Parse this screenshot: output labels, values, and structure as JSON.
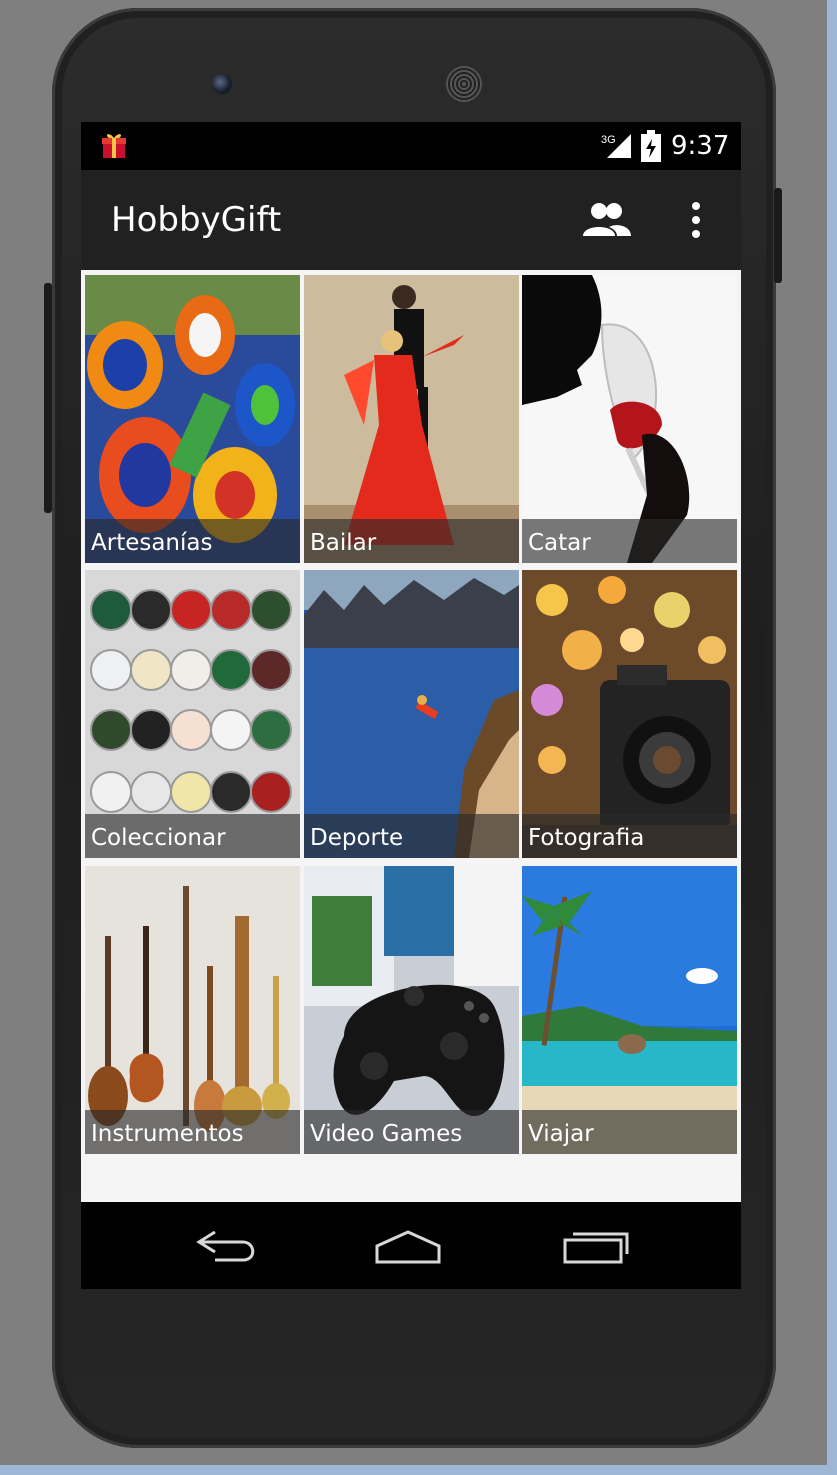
{
  "status_bar": {
    "network": "3G",
    "time": "9:37"
  },
  "app_bar": {
    "title": "HobbyGift",
    "actions": [
      {
        "icon": "people-icon"
      },
      {
        "icon": "more-vert-icon"
      }
    ]
  },
  "hobbies": [
    {
      "label": "Artesanías"
    },
    {
      "label": "Bailar"
    },
    {
      "label": "Catar"
    },
    {
      "label": "Coleccionar"
    },
    {
      "label": "Deporte"
    },
    {
      "label": "Fotografia"
    },
    {
      "label": "Instrumentos"
    },
    {
      "label": "Video Games"
    },
    {
      "label": "Viajar"
    }
  ],
  "nav_bar": {
    "buttons": [
      {
        "icon": "back-icon"
      },
      {
        "icon": "home-icon"
      },
      {
        "icon": "recents-icon"
      }
    ]
  },
  "colors": {
    "app_bar": "#212121",
    "status_bar": "#000000",
    "caption_overlay": "#282828",
    "screen_background": "#f5f5f5"
  }
}
